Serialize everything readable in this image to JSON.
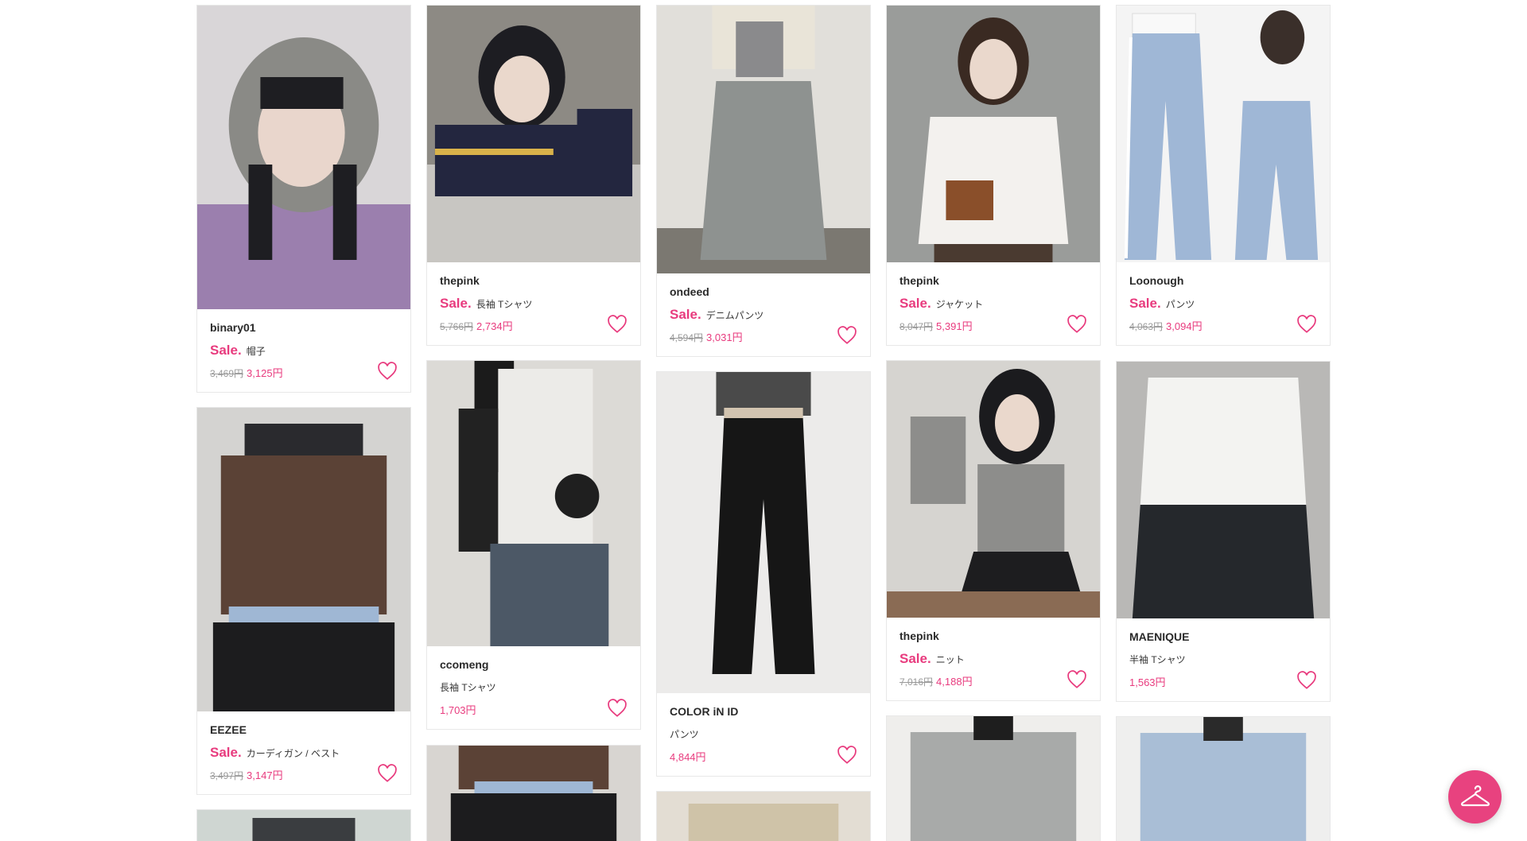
{
  "sale_label": "Sale.",
  "products": [
    {
      "brand": "binary01",
      "category": "帽子",
      "old_price": "3,469円",
      "price": "3,125円",
      "sale": true
    },
    {
      "brand": "thepink",
      "category": "長袖 Tシャツ",
      "old_price": "5,766円",
      "price": "2,734円",
      "sale": true
    },
    {
      "brand": "ondeed",
      "category": "デニムパンツ",
      "old_price": "4,594円",
      "price": "3,031円",
      "sale": true
    },
    {
      "brand": "thepink",
      "category": "ジャケット",
      "old_price": "8,047円",
      "price": "5,391円",
      "sale": true
    },
    {
      "brand": "Loonough",
      "category": "パンツ",
      "old_price": "4,063円",
      "price": "3,094円",
      "sale": true
    },
    {
      "brand": "EEZEE",
      "category": "カーディガン / ベスト",
      "old_price": "3,497円",
      "price": "3,147円",
      "sale": true
    },
    {
      "brand": "ccomeng",
      "category": "長袖 Tシャツ",
      "price": "1,703円",
      "sale": false
    },
    {
      "brand": "COLOR iN ID",
      "category": "パンツ",
      "price": "4,844円",
      "sale": false
    },
    {
      "brand": "thepink",
      "category": "ニット",
      "old_price": "7,016円",
      "price": "4,188円",
      "sale": true
    },
    {
      "brand": "MAENIQUE",
      "category": "半袖 Tシャツ",
      "price": "1,563円",
      "sale": false
    }
  ],
  "icons": {
    "favorite": "heart-outline-icon",
    "closet": "hanger-icon"
  },
  "colors": {
    "accent": "#e83b7e",
    "fab": "#e8427f"
  }
}
